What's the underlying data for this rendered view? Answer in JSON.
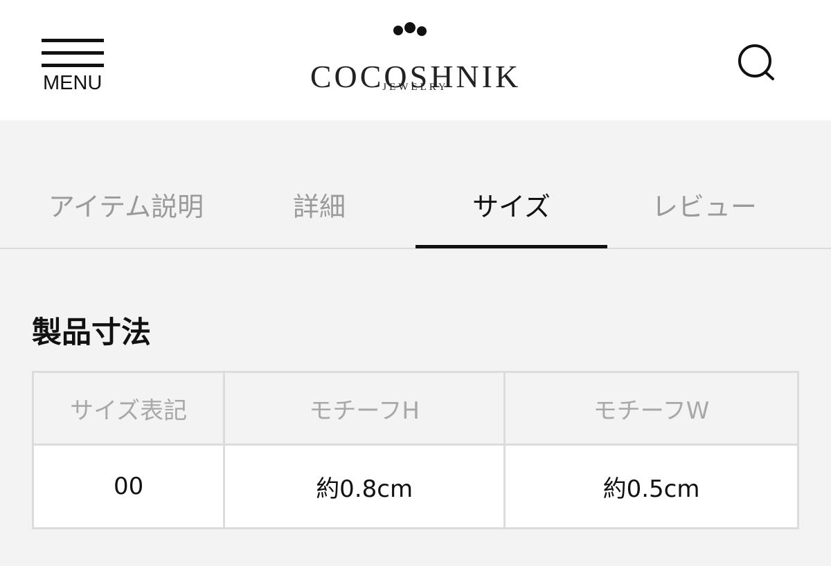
{
  "header": {
    "menu_label": "MENU",
    "logo_text": "COCOSHNIK",
    "logo_subtext": "JEWELRY",
    "menu_icon": "hamburger-icon",
    "search_icon": "search-icon"
  },
  "tabs": [
    {
      "label": "アイテム説明",
      "active": false
    },
    {
      "label": "詳細",
      "active": false
    },
    {
      "label": "サイズ",
      "active": true
    },
    {
      "label": "レビュー",
      "active": false
    }
  ],
  "section": {
    "title": "製品寸法"
  },
  "size_table": {
    "headers": [
      "サイズ表記",
      "モチーフH",
      "モチーフW"
    ],
    "rows": [
      [
        "00",
        "約0.8cm",
        "約0.5cm"
      ]
    ]
  },
  "colors": {
    "background": "#f3f3f3",
    "header_background": "#ffffff",
    "active_tab": "#111111",
    "inactive_tab": "#9a9a9a",
    "table_border": "#dcdcdc"
  }
}
